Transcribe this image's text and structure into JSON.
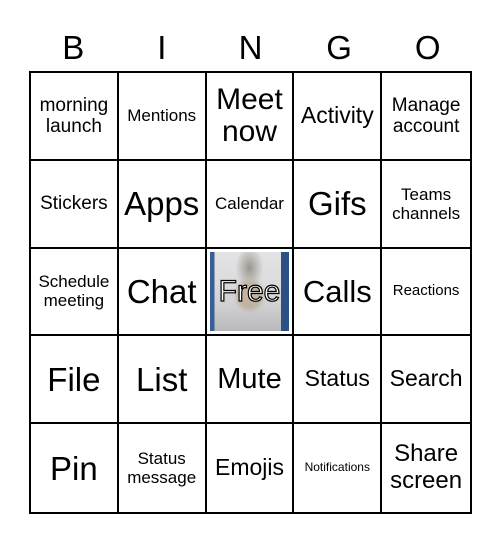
{
  "header": [
    "B",
    "I",
    "N",
    "G",
    "O"
  ],
  "cells": [
    [
      "morning launch",
      "Mentions",
      "Meet now",
      "Activity",
      "Manage account"
    ],
    [
      "Stickers",
      "Apps",
      "Calendar",
      "Gifs",
      "Teams channels"
    ],
    [
      "Schedule meeting",
      "Chat",
      "Free",
      "Calls",
      "Reactions"
    ],
    [
      "File",
      "List",
      "Mute",
      "Status",
      "Search"
    ],
    [
      "Pin",
      "Status message",
      "Emojis",
      "Notifications",
      "Share screen"
    ]
  ],
  "free_space": {
    "label": "Free",
    "image": "dog-photo"
  }
}
